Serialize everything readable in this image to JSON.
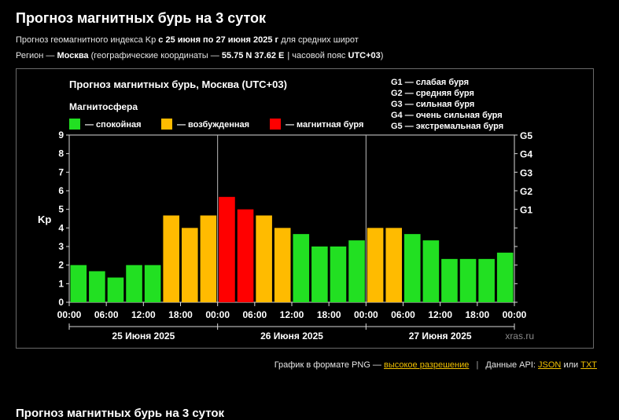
{
  "page": {
    "title": "Прогноз магнитных бурь на 3 суток",
    "line1": {
      "prefix": "Прогноз геомагнитного индекса Kp",
      "range": "с 25 июня по 27 июня 2025 г",
      "suffix": "для средних широт"
    },
    "line2": {
      "region_label": "Регион —",
      "region": "Москва",
      "coords_label": "(географические координаты —",
      "coords": "55.75 N 37.62 E",
      "tz_label": "| часовой пояс",
      "tz": "UTC+03",
      "close": ")"
    },
    "next_heading": "Прогноз магнитных бурь на 3 суток"
  },
  "footer": {
    "png_label": "График в формате PNG —",
    "png_link": "высокое разрешение",
    "api_label": "Данные API:",
    "json_link": "JSON",
    "or": "или",
    "txt_link": "TXT"
  },
  "colors": {
    "calm": "#22e022",
    "active": "#ffbb00",
    "storm": "#ff0000",
    "background": "#000000",
    "frame": "#6a6a6a"
  },
  "chart_data": {
    "type": "bar",
    "title": "Прогноз магнитных бурь, Москва (UTC+03)",
    "ylabel": "Kp",
    "ylim": [
      0,
      9
    ],
    "yticks": [
      "0",
      "1",
      "2",
      "3",
      "4",
      "5",
      "6",
      "7",
      "8",
      "9"
    ],
    "right_axis": [
      {
        "label": "G1",
        "kp": 5
      },
      {
        "label": "G2",
        "kp": 6
      },
      {
        "label": "G3",
        "kp": 7
      },
      {
        "label": "G4",
        "kp": 8
      },
      {
        "label": "G5",
        "kp": 9
      }
    ],
    "xtick_labels": [
      "00:00",
      "06:00",
      "12:00",
      "18:00",
      "00:00",
      "06:00",
      "12:00",
      "18:00",
      "00:00",
      "06:00",
      "12:00",
      "18:00",
      "00:00"
    ],
    "days": [
      "25 Июня 2025",
      "26 Июня 2025",
      "27 Июня 2025"
    ],
    "legend_title": "Магнитосфера",
    "legend": [
      {
        "label": "— спокойная",
        "color": "#22e022"
      },
      {
        "label": "— возбужденная",
        "color": "#ffbb00"
      },
      {
        "label": "— магнитная буря",
        "color": "#ff0000"
      }
    ],
    "g_scale": [
      "G1 — слабая буря",
      "G2 — средняя буря",
      "G3 — сильная буря",
      "G4 — очень сильная буря",
      "G5 — экстремальная буря"
    ],
    "watermark": "xras.ru",
    "values": [
      2.0,
      1.67,
      1.33,
      2.0,
      2.0,
      4.67,
      4.0,
      4.67,
      5.67,
      5.0,
      4.67,
      4.0,
      3.67,
      3.0,
      3.0,
      3.33,
      4.0,
      4.0,
      3.67,
      3.33,
      2.33,
      2.33,
      2.33,
      2.67
    ],
    "categories": [
      "calm",
      "calm",
      "calm",
      "calm",
      "calm",
      "active",
      "active",
      "active",
      "storm",
      "storm",
      "active",
      "active",
      "calm",
      "calm",
      "calm",
      "calm",
      "active",
      "active",
      "calm",
      "calm",
      "calm",
      "calm",
      "calm",
      "calm"
    ]
  }
}
